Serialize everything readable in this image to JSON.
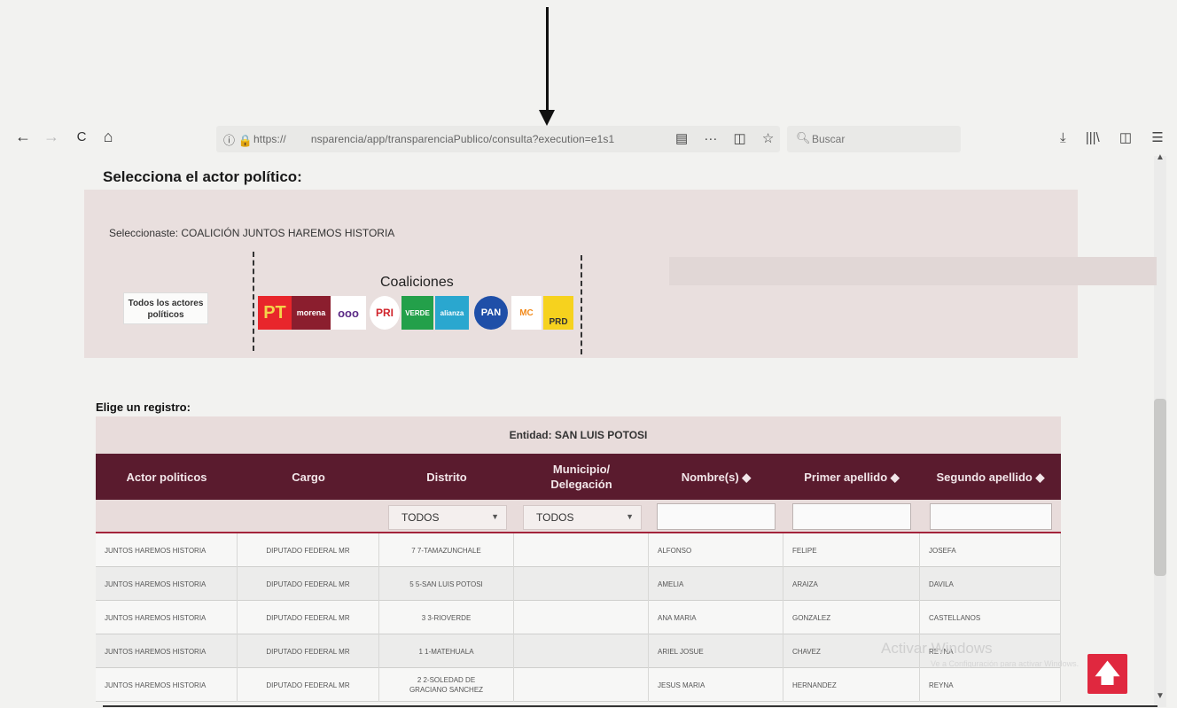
{
  "browser": {
    "url_prefix": "https://",
    "url_path": "nsparencia/app/transparenciaPublico/consulta?execution=e1s1",
    "search_placeholder": "Buscar",
    "nav": {
      "back": "←",
      "forward": "→",
      "reload": "C",
      "home": "⌂"
    },
    "url_actions": {
      "reader": "▤",
      "more": "···",
      "pocket": "◫",
      "bookmark": "☆"
    },
    "right": {
      "download": "⤓",
      "library": "|||\\",
      "sidebar": "◫",
      "menu": "☰"
    }
  },
  "page": {
    "section_title": "Selecciona el actor político:",
    "selected_text": "Seleccionaste: COALICIÓN JUNTOS HAREMOS HISTORIA",
    "all_actors_label": "Todos los actores políticos",
    "coalitions_title": "Coaliciones",
    "registry_title": "Elige un registro:",
    "entity": "Entidad: SAN LUIS POTOSI"
  },
  "logos": [
    {
      "name": "pt",
      "text": "PT",
      "bg": "#e8262b",
      "fg": "#f4d44a"
    },
    {
      "name": "morena",
      "text": "morena",
      "bg": "#8b1e2e",
      "fg": "#ffffff"
    },
    {
      "name": "encuentro-social",
      "text": "ooo",
      "bg": "#ffffff",
      "fg": "#5b2a86"
    },
    {
      "name": "pri",
      "text": "PRI",
      "bg": "#ffffff",
      "fg": "#d0232a"
    },
    {
      "name": "verde",
      "text": "VERDE",
      "bg": "#23a04a",
      "fg": "#ffffff"
    },
    {
      "name": "nueva-alianza",
      "text": "alianza",
      "bg": "#2aa7cf",
      "fg": "#ffffff"
    },
    {
      "name": "pan",
      "text": "PAN",
      "bg": "#1f4fa8",
      "fg": "#ffffff"
    },
    {
      "name": "movimiento-ciudadano",
      "text": "MC",
      "bg": "#ffffff",
      "fg": "#f28a1b"
    },
    {
      "name": "prd",
      "text": "PRD",
      "bg": "#f6d21e",
      "fg": "#333333"
    }
  ],
  "table": {
    "headers": [
      "Actor politicos",
      "Cargo",
      "Distrito",
      "Municipio/ Delegación",
      "Nombre(s) ◆",
      "Primer apellido ◆",
      "Segundo apellido ◆"
    ],
    "filters": {
      "distrito": "TODOS",
      "municipio": "TODOS"
    },
    "rows": [
      [
        "JUNTOS HAREMOS HISTORIA",
        "DIPUTADO FEDERAL MR",
        "7 7-TAMAZUNCHALE",
        "",
        "ALFONSO",
        "FELIPE",
        "JOSEFA"
      ],
      [
        "JUNTOS HAREMOS HISTORIA",
        "DIPUTADO FEDERAL MR",
        "5 5-SAN LUIS POTOSI",
        "",
        "AMELIA",
        "ARAIZA",
        "DAVILA"
      ],
      [
        "JUNTOS HAREMOS HISTORIA",
        "DIPUTADO FEDERAL MR",
        "3 3-RIOVERDE",
        "",
        "ANA MARIA",
        "GONZALEZ",
        "CASTELLANOS"
      ],
      [
        "JUNTOS HAREMOS HISTORIA",
        "DIPUTADO FEDERAL MR",
        "1 1-MATEHUALA",
        "",
        "ARIEL JOSUE",
        "CHAVEZ",
        "REYNA"
      ],
      [
        "JUNTOS HAREMOS HISTORIA",
        "DIPUTADO FEDERAL MR",
        "2 2-SOLEDAD DE GRACIANO SANCHEZ",
        "",
        "JESUS MARIA",
        "HERNANDEZ",
        "REYNA"
      ]
    ]
  },
  "watermark": {
    "line1": "Activar Windows",
    "line2": "Ve a Configuración para activar Windows."
  },
  "back_to_top": "🡅",
  "colors": {
    "header_bg": "#5a1b2e",
    "accent_red": "#e0283f",
    "panel_bg": "#e9dfde"
  }
}
